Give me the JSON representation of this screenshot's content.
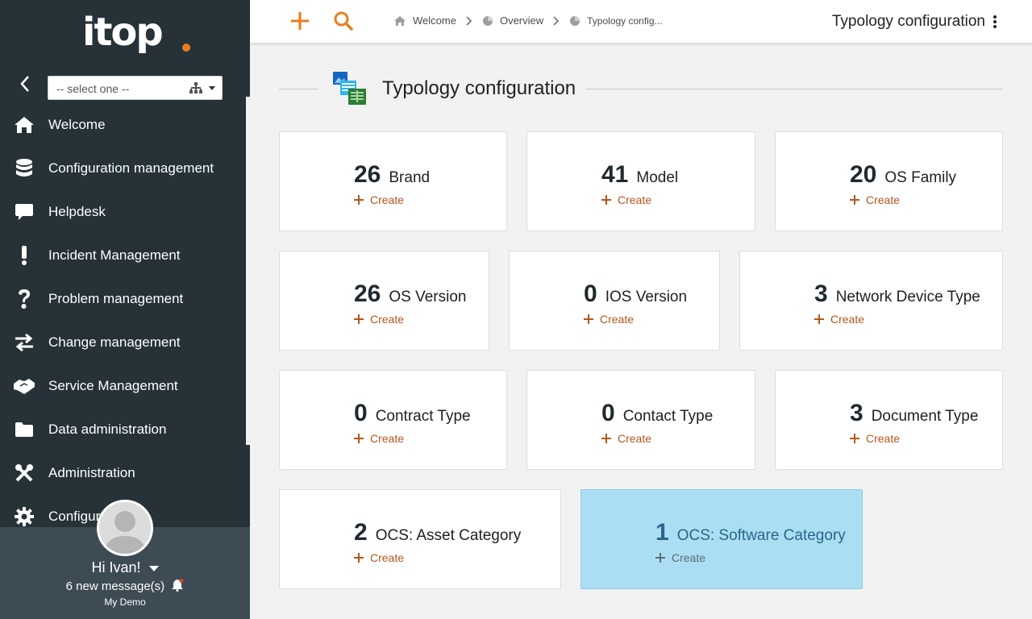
{
  "brand": {
    "logo_text": "itop"
  },
  "sidebar": {
    "org_select": {
      "value": "-- select one --"
    },
    "items": [
      {
        "label": "Welcome",
        "icon": "home-icon"
      },
      {
        "label": "Configuration management",
        "icon": "database-icon"
      },
      {
        "label": "Helpdesk",
        "icon": "comment-icon"
      },
      {
        "label": "Incident Management",
        "icon": "exclamation-icon"
      },
      {
        "label": "Problem management",
        "icon": "question-icon"
      },
      {
        "label": "Change management",
        "icon": "exchange-icon"
      },
      {
        "label": "Service Management",
        "icon": "handshake-icon"
      },
      {
        "label": "Data administration",
        "icon": "folder-icon"
      },
      {
        "label": "Administration",
        "icon": "tools-icon"
      },
      {
        "label": "Configur",
        "icon": "gear-icon"
      }
    ],
    "user": {
      "greeting": "Hi Ivan!",
      "messages": "6 new message(s)",
      "organization": "My Demo"
    }
  },
  "topbar": {
    "breadcrumbs": [
      "Welcome",
      "Overview",
      "Typology config..."
    ],
    "title": "Typology configuration"
  },
  "main": {
    "title": "Typology configuration",
    "create_label": "Create",
    "cards": [
      {
        "count": "26",
        "name": "Brand"
      },
      {
        "count": "41",
        "name": "Model"
      },
      {
        "count": "20",
        "name": "OS Family"
      },
      {
        "count": "26",
        "name": "OS Version"
      },
      {
        "count": "0",
        "name": "IOS Version"
      },
      {
        "count": "3",
        "name": "Network Device Type"
      },
      {
        "count": "0",
        "name": "Contract Type"
      },
      {
        "count": "0",
        "name": "Contact Type"
      },
      {
        "count": "3",
        "name": "Document Type"
      },
      {
        "count": "2",
        "name": "OCS: Asset Category"
      },
      {
        "count": "1",
        "name": "OCS: Software Category",
        "highlighted": true
      }
    ]
  },
  "colors": {
    "sidebar_bg": "#263238",
    "accent": "#ea7d1e",
    "create_link": "#b4561a",
    "highlight_card": "#abdef3"
  }
}
